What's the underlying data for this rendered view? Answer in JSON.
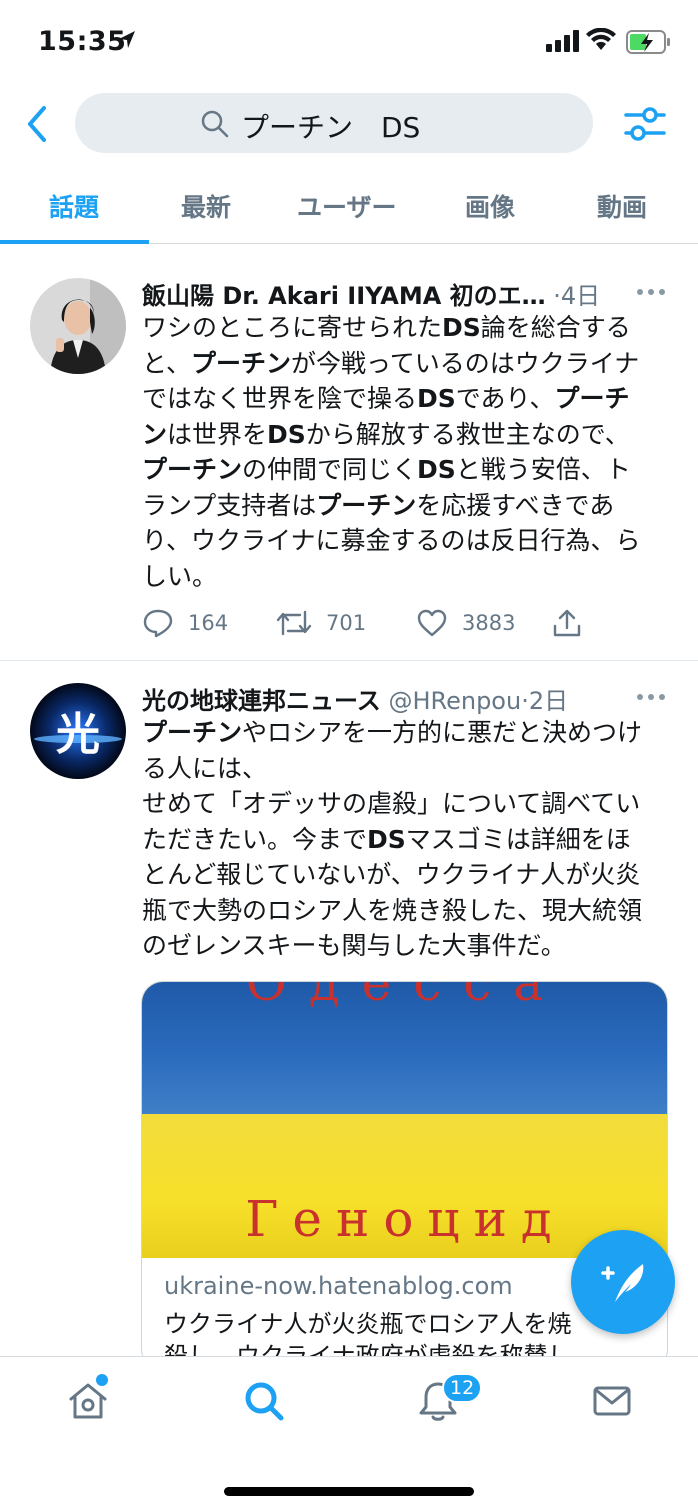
{
  "status_bar": {
    "time": "15:35"
  },
  "search": {
    "query": "プーチン　DS"
  },
  "tabs": [
    {
      "label": "話題",
      "active": true
    },
    {
      "label": "最新",
      "active": false
    },
    {
      "label": "ユーザー",
      "active": false
    },
    {
      "label": "画像",
      "active": false
    },
    {
      "label": "動画",
      "active": false
    }
  ],
  "tweets": [
    {
      "name": "飯山陽 Dr. Akari IIYAMA 初のエ…",
      "meta": "·4日",
      "lines": [
        "ワシのところに寄せられたDS論を総合する",
        "と、プーチンが今戦っているのはウクライナ",
        "ではなく世界を陰で操るDSであり、プーチ",
        "ンは世界をDSから解放する救世主なので、",
        "プーチンの仲間で同じくDSと戦う安倍、ト",
        "ランプ支持者はプーチンを応援すべきであ",
        "り、ウクライナに募金するのは反日行為、ら",
        "しい。"
      ],
      "replies": "164",
      "retweets": "701",
      "likes": "3883"
    },
    {
      "name": "光の地球連邦ニュース",
      "handle": "@HRenpou",
      "meta": "·2日",
      "avatar_char": "光",
      "lines": [
        "プーチンやロシアを一方的に悪だと決めつけ",
        "る人には、",
        "せめて「オデッサの虐殺」について調べてい",
        "ただきたい。今までDSマスゴミは詳細をほ",
        "とんど報じていないが、ウクライナ人が火炎",
        "瓶で大勢のロシア人を焼き殺した、現大統領",
        "のゼレンスキーも関与した大事件だ。"
      ],
      "card": {
        "image_top_text": "Одесса",
        "image_bottom_text": "Геноцид",
        "domain": "ukraine-now.hatenablog.com",
        "desc_line1": "ウクライナ人が火炎瓶でロシア人を焼",
        "desc_line2": "殺し、ウクライナ政府が虐殺を称賛し…"
      }
    }
  ],
  "bottom_nav": {
    "notifications_badge": "12"
  },
  "colors": {
    "accent": "#1da1f2",
    "secondary_text": "#657786"
  }
}
